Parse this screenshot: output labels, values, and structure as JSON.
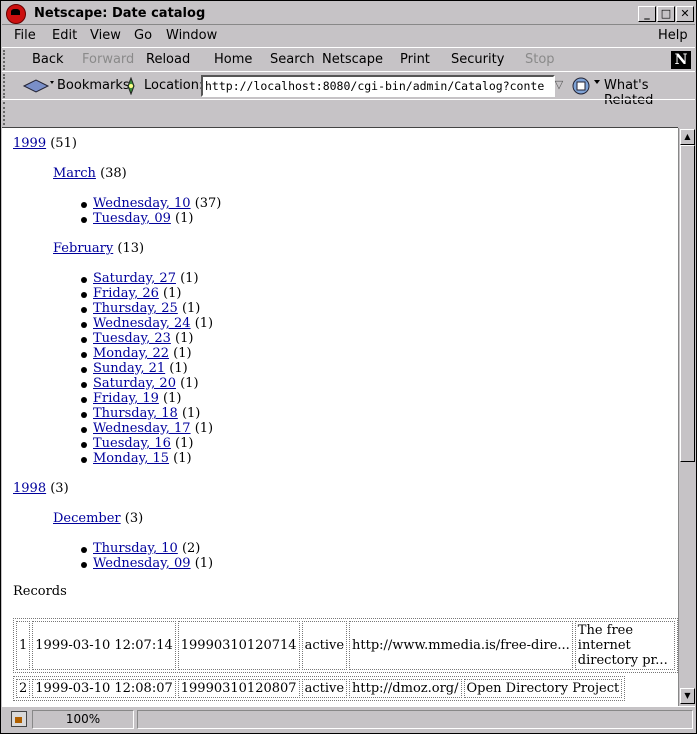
{
  "window": {
    "title": "Netscape: Date catalog"
  },
  "menubar": [
    "File",
    "Edit",
    "View",
    "Go",
    "Window",
    "Help"
  ],
  "toolbar": {
    "back": "Back",
    "forward": "Forward",
    "reload": "Reload",
    "home": "Home",
    "search": "Search",
    "netscape": "Netscape",
    "print": "Print",
    "security": "Security",
    "stop": "Stop"
  },
  "location": {
    "bookmarks_label": "Bookmarks",
    "location_label": "Location:",
    "url": "http://localhost:8080/cgi-bin/admin/Catalog?conte",
    "whats_related": "What's Related"
  },
  "catalog": [
    {
      "year": "1999",
      "count": "(51)",
      "months": [
        {
          "name": "March",
          "count": "(38)",
          "days": [
            {
              "label": "Wednesday, 10",
              "count": "(37)"
            },
            {
              "label": "Tuesday, 09",
              "count": "(1)"
            }
          ]
        },
        {
          "name": "February",
          "count": "(13)",
          "days": [
            {
              "label": "Saturday, 27",
              "count": "(1)"
            },
            {
              "label": "Friday, 26",
              "count": "(1)"
            },
            {
              "label": "Thursday, 25",
              "count": "(1)"
            },
            {
              "label": "Wednesday, 24",
              "count": "(1)"
            },
            {
              "label": "Tuesday, 23",
              "count": "(1)"
            },
            {
              "label": "Monday, 22",
              "count": "(1)"
            },
            {
              "label": "Sunday, 21",
              "count": "(1)"
            },
            {
              "label": "Saturday, 20",
              "count": "(1)"
            },
            {
              "label": "Friday, 19",
              "count": "(1)"
            },
            {
              "label": "Thursday, 18",
              "count": "(1)"
            },
            {
              "label": "Wednesday, 17",
              "count": "(1)"
            },
            {
              "label": "Tuesday, 16",
              "count": "(1)"
            },
            {
              "label": "Monday, 15",
              "count": "(1)"
            }
          ]
        }
      ]
    },
    {
      "year": "1998",
      "count": "(3)",
      "months": [
        {
          "name": "December",
          "count": "(3)",
          "days": [
            {
              "label": "Thursday, 10",
              "count": "(2)"
            },
            {
              "label": "Wednesday, 09",
              "count": "(1)"
            }
          ]
        }
      ]
    }
  ],
  "records_heading": "Records",
  "records": [
    [
      "1",
      "1999-03-10 12:07:14",
      "19990310120714",
      "active",
      "http://www.mmedia.is/free-dire...",
      "The free internet directory pr..."
    ],
    [
      "2",
      "1999-03-10 12:08:07",
      "19990310120807",
      "active",
      "http://dmoz.org/",
      "Open Directory Project"
    ]
  ],
  "status": {
    "zoom": "100%"
  }
}
